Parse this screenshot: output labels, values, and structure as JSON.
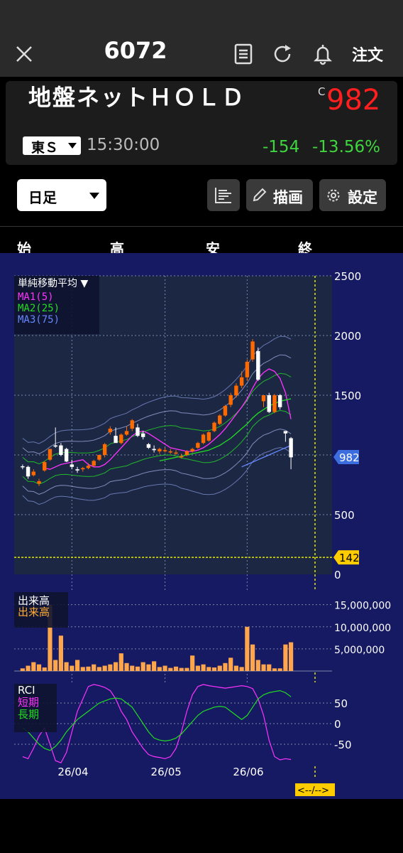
{
  "header": {
    "close_icon": "close-icon",
    "stock_code": "6072",
    "icons": [
      "document-icon",
      "refresh-icon",
      "bell-icon"
    ],
    "order_label": "注文"
  },
  "quote": {
    "name": "地盤ネットＨＯＬＤ",
    "price_flag": "C",
    "price": "982",
    "market": "東Ｓ",
    "time": "15:30:00",
    "change": "-154",
    "change_pct": "-13.56%",
    "colors": {
      "price": "#ff1f1f",
      "change": "#3ed63e"
    }
  },
  "toolbar": {
    "period_value": "日足",
    "list_icon": "bars-icon",
    "draw_label": "描画",
    "settings_label": "設定"
  },
  "ohlc_labels": [
    "始",
    "高",
    "安",
    "終"
  ],
  "chart_data": [
    {
      "type": "candlestick",
      "legend_title": "単純移動平均",
      "legend": [
        {
          "name": "MA1(5)",
          "color": "#ff33ff"
        },
        {
          "name": "MA2(25)",
          "color": "#22dd22"
        },
        {
          "name": "MA3(75)",
          "color": "#6688ff"
        }
      ],
      "y_ticks": [
        "2500",
        "2000",
        "1500",
        "500",
        "0"
      ],
      "ylim": [
        0,
        2500
      ],
      "current_price_tag": "982",
      "line_tag": "142",
      "line_value": 142,
      "candle_colors": {
        "up": "#ff6a00",
        "down": "#ffffff"
      },
      "candles": [
        [
          905,
          920,
          880,
          900
        ],
        [
          900,
          910,
          800,
          820
        ],
        [
          830,
          880,
          820,
          860
        ],
        [
          760,
          800,
          740,
          780
        ],
        [
          870,
          950,
          860,
          940
        ],
        [
          960,
          1050,
          950,
          1050
        ],
        [
          1080,
          1230,
          1060,
          1070
        ],
        [
          1080,
          1100,
          990,
          1000
        ],
        [
          1050,
          1060,
          940,
          945
        ],
        [
          920,
          960,
          880,
          900
        ],
        [
          880,
          900,
          850,
          870
        ],
        [
          880,
          900,
          860,
          890
        ],
        [
          890,
          930,
          880,
          910
        ],
        [
          910,
          960,
          900,
          950
        ],
        [
          960,
          1000,
          950,
          1000
        ],
        [
          1000,
          1100,
          980,
          1090
        ],
        [
          1190,
          1240,
          1170,
          1220
        ],
        [
          1160,
          1230,
          1150,
          1100
        ],
        [
          1100,
          1180,
          1090,
          1170
        ],
        [
          1170,
          1240,
          1160,
          1200
        ],
        [
          1220,
          1300,
          1200,
          1290
        ],
        [
          1230,
          1260,
          1150,
          1160
        ],
        [
          1180,
          1200,
          1130,
          1150
        ],
        [
          1090,
          1100,
          1050,
          1060
        ],
        [
          1050,
          1080,
          1020,
          1040
        ],
        [
          1030,
          1060,
          1010,
          1050
        ],
        [
          1040,
          1060,
          1020,
          1040
        ],
        [
          1030,
          1050,
          1010,
          1030
        ],
        [
          1020,
          1040,
          1000,
          1020
        ],
        [
          980,
          1010,
          970,
          990
        ],
        [
          1000,
          1040,
          990,
          1030
        ],
        [
          1030,
          1060,
          1020,
          1050
        ],
        [
          1060,
          1110,
          1050,
          1100
        ],
        [
          1100,
          1180,
          1090,
          1170
        ],
        [
          1120,
          1200,
          1110,
          1190
        ],
        [
          1200,
          1280,
          1190,
          1270
        ],
        [
          1260,
          1340,
          1250,
          1330
        ],
        [
          1330,
          1420,
          1320,
          1410
        ],
        [
          1420,
          1520,
          1400,
          1500
        ],
        [
          1500,
          1600,
          1480,
          1580
        ],
        [
          1580,
          1700,
          1560,
          1650
        ],
        [
          1650,
          1800,
          1620,
          1780
        ],
        [
          1800,
          1970,
          1780,
          1950
        ],
        [
          1870,
          1900,
          1620,
          1630
        ],
        [
          1450,
          1460,
          1400,
          1500
        ],
        [
          1500,
          1520,
          1350,
          1360
        ],
        [
          1360,
          1510,
          1350,
          1500
        ],
        [
          1500,
          1510,
          1380,
          1400
        ],
        [
          1200,
          1190,
          1110,
          1180
        ],
        [
          1140,
          1150,
          880,
          980
        ]
      ],
      "ma_lines": [
        {
          "name": "MA1(5)",
          "color": "#ff33ff",
          "values": [
            null,
            null,
            null,
            null,
            890,
            880,
            900,
            920,
            930,
            940,
            950,
            960,
            920,
            900,
            900,
            920,
            960,
            1010,
            1060,
            1110,
            1160,
            1190,
            1200,
            1180,
            1150,
            1120,
            1090,
            1060,
            1050,
            1040,
            1030,
            1030,
            1040,
            1060,
            1090,
            1130,
            1170,
            1220,
            1280,
            1340,
            1400,
            1470,
            1560,
            1640,
            1690,
            1720,
            1700,
            1640,
            1520,
            1300
          ]
        },
        {
          "name": "MA2(25)",
          "color": "#22dd22",
          "values": [
            null,
            null,
            null,
            null,
            null,
            null,
            null,
            null,
            null,
            null,
            null,
            null,
            null,
            null,
            null,
            null,
            null,
            null,
            null,
            null,
            null,
            null,
            null,
            null,
            null,
            950,
            960,
            970,
            980,
            990,
            1000,
            1010,
            1020,
            1030,
            1040,
            1060,
            1080,
            1110,
            1140,
            1180,
            1220,
            1260,
            1310,
            1350,
            1380,
            1410,
            1430,
            1450,
            1460,
            1470
          ]
        },
        {
          "name": "MA3(75)",
          "color": "#6688ff",
          "values": [
            null,
            null,
            null,
            null,
            null,
            null,
            null,
            null,
            null,
            null,
            null,
            null,
            null,
            null,
            null,
            null,
            null,
            null,
            null,
            null,
            null,
            null,
            null,
            null,
            null,
            null,
            null,
            null,
            null,
            null,
            null,
            null,
            null,
            null,
            null,
            null,
            null,
            null,
            null,
            null,
            900,
            920,
            940,
            960,
            980,
            1000,
            1020,
            1040,
            1060,
            1080
          ]
        }
      ],
      "x_labels": [
        "26/04",
        "26/05",
        "26/06"
      ],
      "x_label_positions": [
        9,
        26,
        41
      ]
    },
    {
      "type": "bar",
      "legend": [
        {
          "name": "出来高",
          "color": "#ffffff"
        },
        {
          "name": "出来高",
          "color": "#ffaa33"
        }
      ],
      "y_ticks": [
        "15,000,000",
        "10,000,000",
        "5,000,000"
      ],
      "ylim": [
        0,
        18000000
      ],
      "bar_color": "#ffa64d",
      "values": [
        600000,
        1200000,
        2000000,
        1500000,
        800000,
        15000000,
        2500000,
        8000000,
        2000000,
        1200000,
        2500000,
        900000,
        1000000,
        1500000,
        900000,
        1200000,
        1500000,
        2000000,
        4000000,
        1800000,
        1200000,
        1000000,
        2000000,
        1500000,
        2200000,
        900000,
        1200000,
        700000,
        1000000,
        700000,
        700000,
        3500000,
        1200000,
        1500000,
        900000,
        800000,
        1200000,
        1800000,
        3000000,
        1200000,
        900000,
        10000000,
        6000000,
        2500000,
        1500000,
        1500000,
        600000,
        600000,
        6000000,
        6500000
      ]
    },
    {
      "type": "line",
      "legend": [
        {
          "name": "RCI",
          "color": "#ffffff"
        },
        {
          "name": "短期",
          "color": "#ff33ff"
        },
        {
          "name": "長期",
          "color": "#22dd22"
        }
      ],
      "y_ticks": [
        "50",
        "0",
        "-50"
      ],
      "ylim": [
        -100,
        100
      ],
      "series": [
        {
          "name": "短期",
          "color": "#ff33ff",
          "values": [
            -80,
            -85,
            -60,
            -30,
            -10,
            -50,
            -90,
            -95,
            -70,
            -20,
            30,
            60,
            90,
            95,
            92,
            88,
            80,
            60,
            30,
            10,
            -20,
            -40,
            -60,
            -75,
            -80,
            -82,
            -85,
            -80,
            -60,
            -20,
            30,
            70,
            90,
            95,
            92,
            90,
            88,
            86,
            88,
            90,
            92,
            90,
            85,
            60,
            20,
            -40,
            -80,
            -88,
            -85,
            -87
          ]
        },
        {
          "name": "長期",
          "color": "#22dd22",
          "values": [
            -10,
            -20,
            -35,
            -50,
            -60,
            -65,
            -55,
            -40,
            -20,
            -5,
            10,
            20,
            30,
            40,
            50,
            55,
            60,
            62,
            60,
            50,
            40,
            20,
            0,
            -20,
            -35,
            -40,
            -42,
            -40,
            -35,
            -25,
            -10,
            5,
            20,
            30,
            35,
            40,
            42,
            40,
            30,
            20,
            10,
            20,
            40,
            60,
            70,
            75,
            78,
            80,
            75,
            65
          ]
        }
      ],
      "x_labels": [
        "26/04",
        "26/05",
        "26/06"
      ]
    }
  ],
  "footer": {
    "scroll_tag": "<--/-->"
  }
}
